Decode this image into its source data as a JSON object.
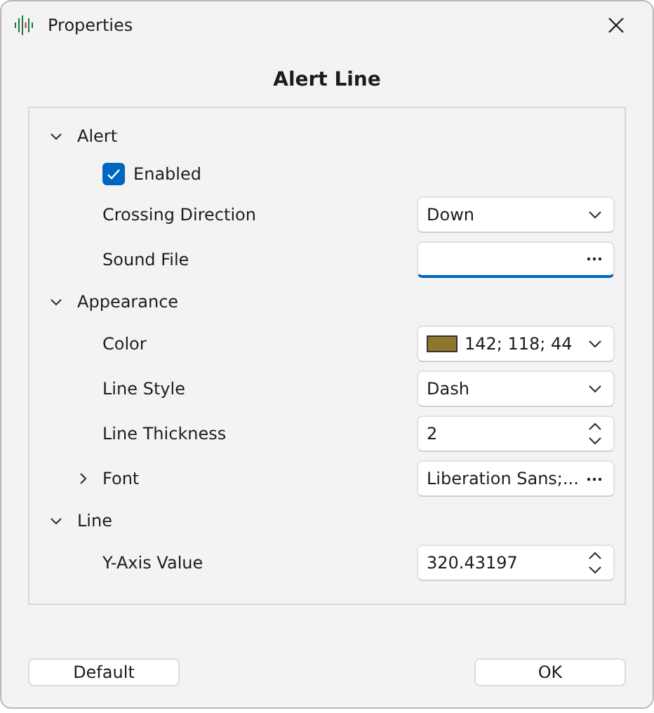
{
  "window": {
    "title": "Properties"
  },
  "heading": "Alert Line",
  "categories": [
    {
      "name": "Alert",
      "expanded": true,
      "properties": [
        {
          "kind": "checkbox",
          "label": "Enabled",
          "checked": true
        },
        {
          "kind": "dropdown",
          "label": "Crossing Direction",
          "value": "Down"
        },
        {
          "kind": "file",
          "label": "Sound File",
          "focused": true
        }
      ]
    },
    {
      "name": "Appearance",
      "expanded": true,
      "properties": [
        {
          "kind": "color",
          "label": "Color",
          "value": "142; 118; 44",
          "color": "#8e762c"
        },
        {
          "kind": "dropdown",
          "label": "Line Style",
          "value": "Dash"
        },
        {
          "kind": "spin",
          "label": "Line Thickness",
          "value": "2"
        },
        {
          "kind": "font",
          "label": "Font",
          "value": "Liberation Sans;...",
          "expanded": false
        }
      ]
    },
    {
      "name": "Line",
      "expanded": true,
      "properties": [
        {
          "kind": "spin",
          "label": "Y-Axis Value",
          "value": "320.43197"
        }
      ]
    }
  ],
  "buttons": [
    {
      "label": "Default"
    },
    {
      "label": "OK"
    }
  ]
}
